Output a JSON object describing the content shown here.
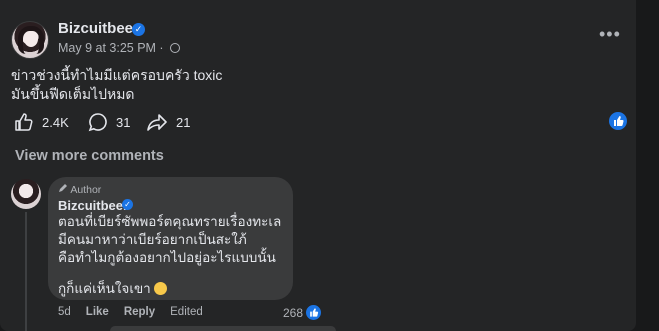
{
  "post": {
    "author": "Bizcuitbeer",
    "meta": "May 9 at 3:25 PM · ",
    "text_line1": "ข่าวช่วงนี้ทำไมมีแต่ครอบครัว toxic",
    "text_line2": "มันขึ้นฟีดเต็มไปหมด",
    "likes": "2.4K",
    "comments": "31",
    "shares": "21",
    "more_icon": "more-options-icon"
  },
  "view_more_comments": "View more comments",
  "comment": {
    "tag": "Author",
    "author": "Bizcuitbeer",
    "line1": "ตอนที่เบียร์ซัพพอร์ตคุณทรายเรื่องทะเล",
    "line2": "มีคนมาหาว่าเบียร์อยากเป็นสะใภ้",
    "line3": "คือทำไมกูต้องอยากไปอยู่อะไรแบบนั้น",
    "line4": "กูก็แค่เห็นใจเขา",
    "time": "5d",
    "like": "Like",
    "reply": "Reply",
    "edited": "Edited",
    "reactions": "268"
  },
  "colors": {
    "background": "#18191a",
    "card": "#242526",
    "bubble": "#3a3b3c",
    "accent": "#1b74e4",
    "secondary_text": "#b0b3b8"
  }
}
